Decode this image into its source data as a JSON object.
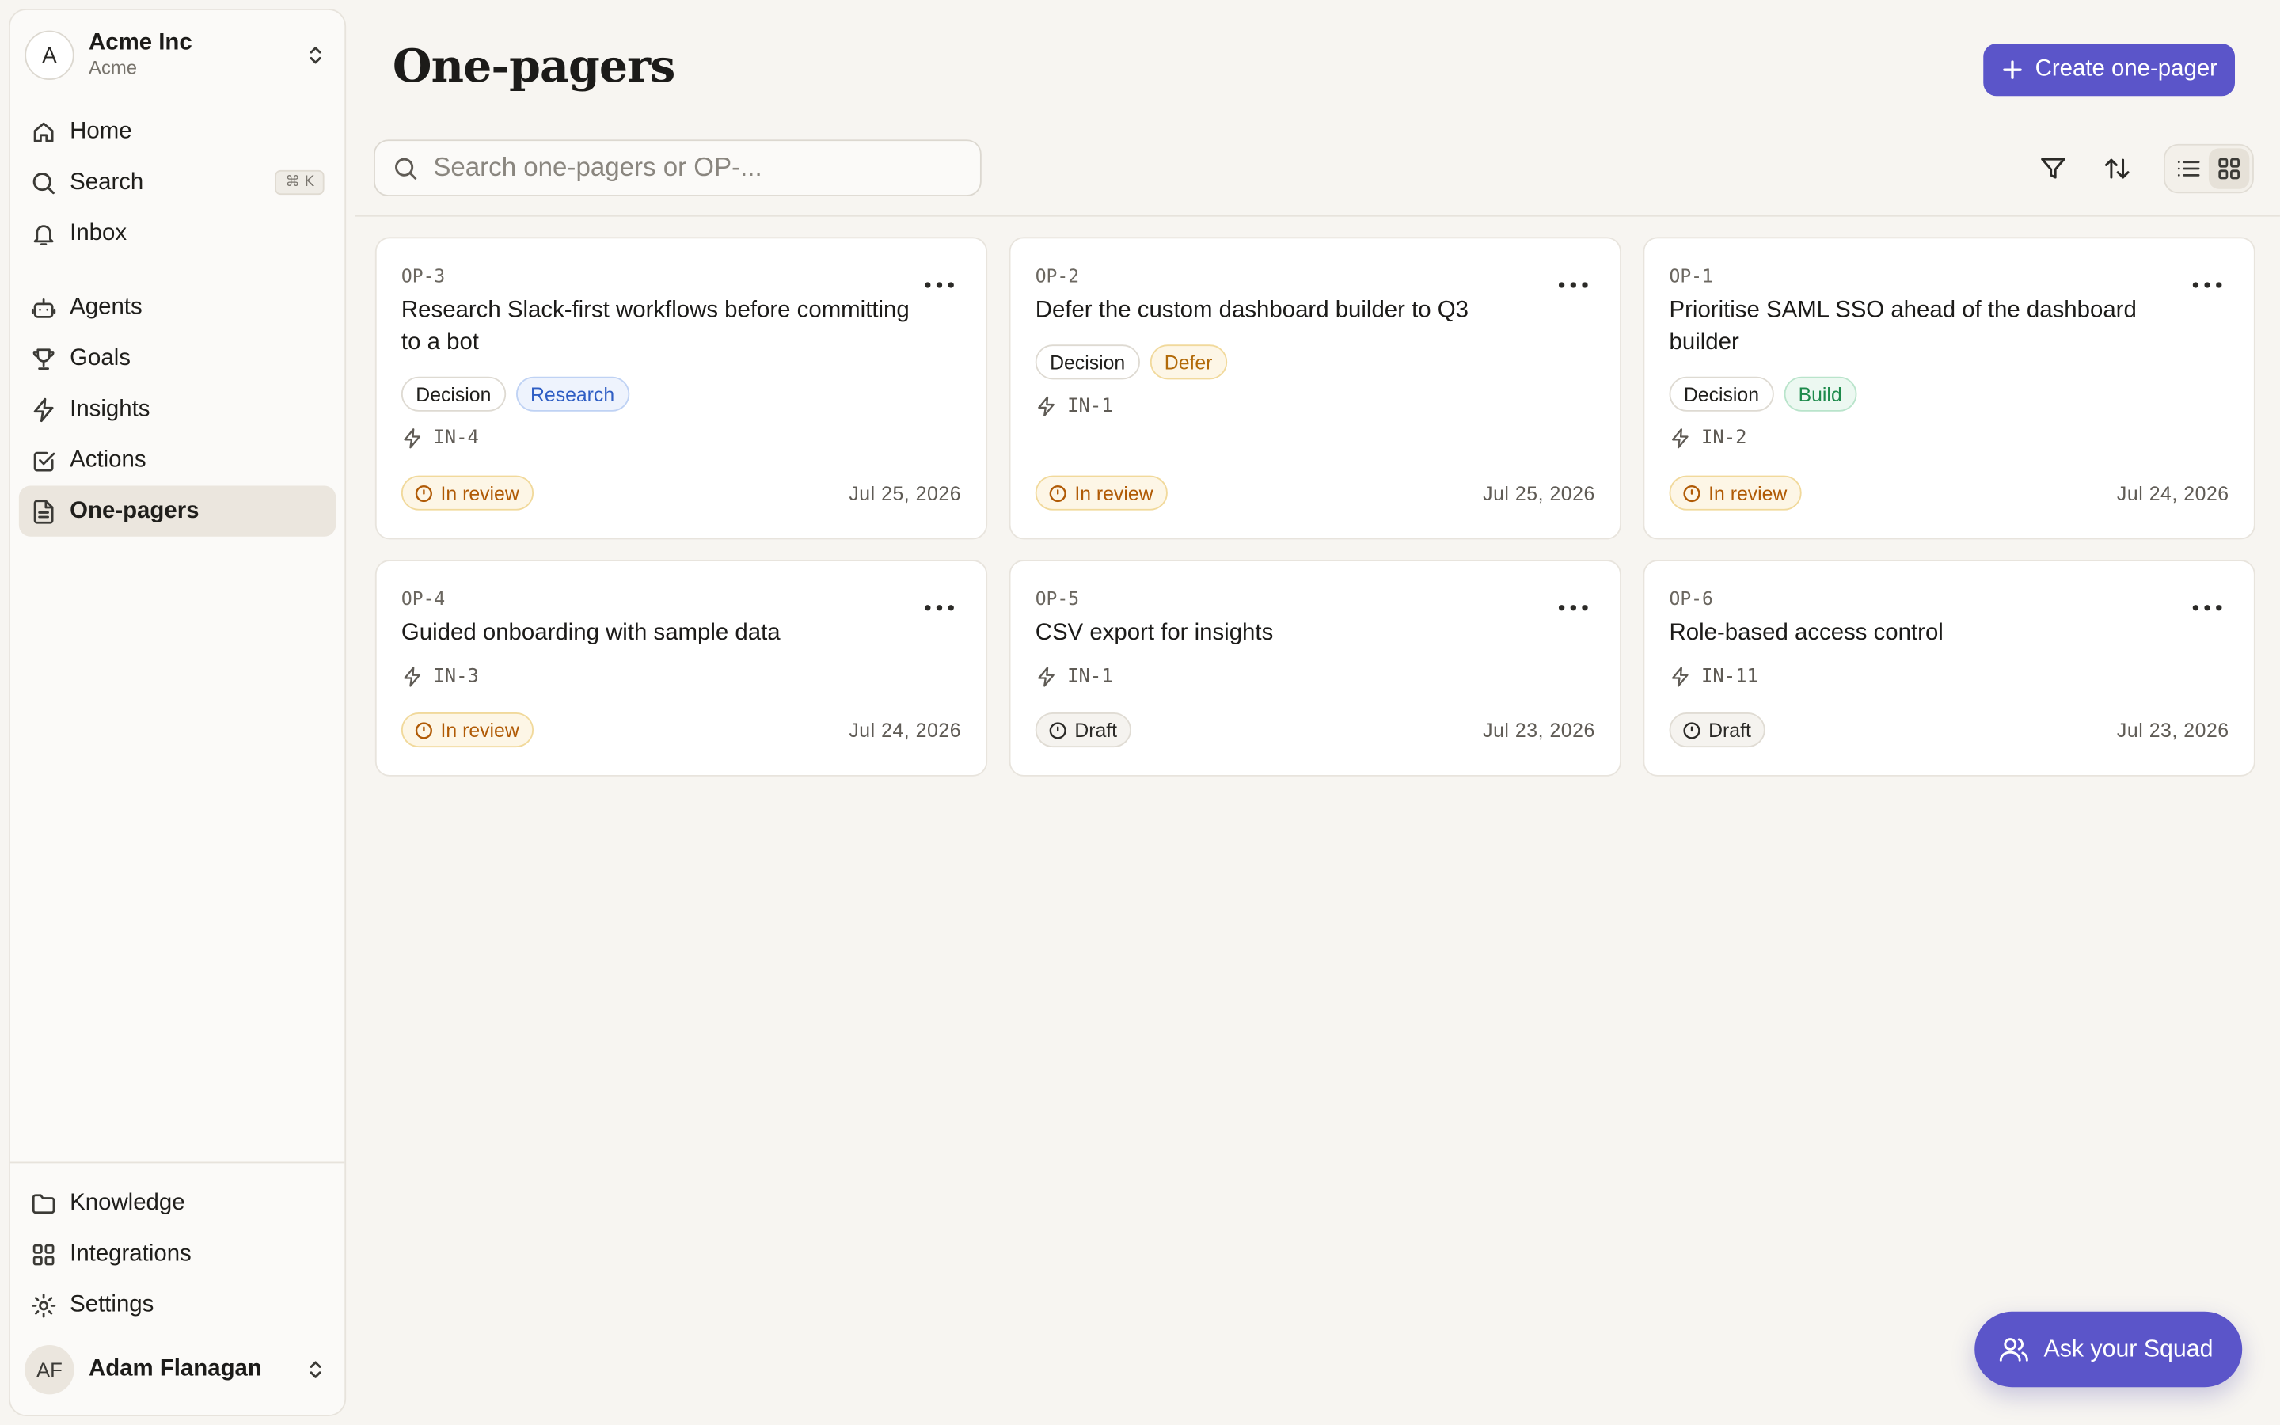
{
  "org": {
    "avatar": "A",
    "name": "Acme Inc",
    "sub": "Acme"
  },
  "nav": {
    "primary": [
      {
        "label": "Home",
        "icon": "home-icon"
      },
      {
        "label": "Search",
        "icon": "search-icon",
        "shortcut": "⌘ K"
      },
      {
        "label": "Inbox",
        "icon": "bell-icon"
      }
    ],
    "secondary": [
      {
        "label": "Agents",
        "icon": "bot-icon"
      },
      {
        "label": "Goals",
        "icon": "trophy-icon"
      },
      {
        "label": "Insights",
        "icon": "bolt-icon"
      },
      {
        "label": "Actions",
        "icon": "checkbox-icon"
      },
      {
        "label": "One-pagers",
        "icon": "document-icon",
        "active": true
      }
    ],
    "footer": [
      {
        "label": "Knowledge",
        "icon": "folder-icon"
      },
      {
        "label": "Integrations",
        "icon": "grid-icon"
      },
      {
        "label": "Settings",
        "icon": "gear-icon"
      }
    ]
  },
  "user": {
    "initials": "AF",
    "name": "Adam Flanagan"
  },
  "page": {
    "title": "One-pagers",
    "create_label": "Create one-pager"
  },
  "search": {
    "placeholder": "Search one-pagers or OP-..."
  },
  "cards": [
    {
      "id": "OP-3",
      "title": "Research Slack-first workflows before committing to a bot",
      "tags": [
        "Decision",
        "Research"
      ],
      "insight": "IN-4",
      "status": "In review",
      "date": "Jul 25, 2026"
    },
    {
      "id": "OP-2",
      "title": "Defer the custom dashboard builder to Q3",
      "tags": [
        "Decision",
        "Defer"
      ],
      "insight": "IN-1",
      "status": "In review",
      "date": "Jul 25, 2026"
    },
    {
      "id": "OP-1",
      "title": "Prioritise SAML SSO ahead of the dashboard builder",
      "tags": [
        "Decision",
        "Build"
      ],
      "insight": "IN-2",
      "status": "In review",
      "date": "Jul 24, 2026"
    },
    {
      "id": "OP-4",
      "title": "Guided onboarding with sample data",
      "tags": [],
      "insight": "IN-3",
      "status": "In review",
      "date": "Jul 24, 2026"
    },
    {
      "id": "OP-5",
      "title": "CSV export for insights",
      "tags": [],
      "insight": "IN-1",
      "status": "Draft",
      "date": "Jul 23, 2026"
    },
    {
      "id": "OP-6",
      "title": "Role-based access control",
      "tags": [],
      "insight": "IN-11",
      "status": "Draft",
      "date": "Jul 23, 2026"
    }
  ],
  "ask": {
    "label": "Ask your Squad"
  },
  "colors": {
    "accent": "#5b55c9",
    "review": "#b05a05",
    "research": "#2f5ec4",
    "build": "#1d8a4b",
    "defer": "#b26a08"
  }
}
